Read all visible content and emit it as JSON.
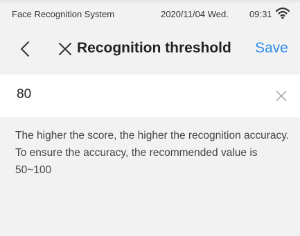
{
  "status_bar": {
    "app_name": "Face Recognition System",
    "date": "2020/11/04 Wed.",
    "time": "09:31",
    "wifi_icon": "wifi-icon"
  },
  "nav": {
    "title": "Recognition threshold",
    "save_label": "Save",
    "back_icon": "chevron-left-icon",
    "close_icon": "close-icon"
  },
  "threshold": {
    "value": "80",
    "clear_icon": "clear-icon"
  },
  "hint": "The higher the score, the higher the recognition accuracy. To ensure the accuracy, the recommended value is 50~100",
  "colors": {
    "accent": "#2f8ef0",
    "background": "#f2f2f2",
    "panel": "#ffffff"
  }
}
